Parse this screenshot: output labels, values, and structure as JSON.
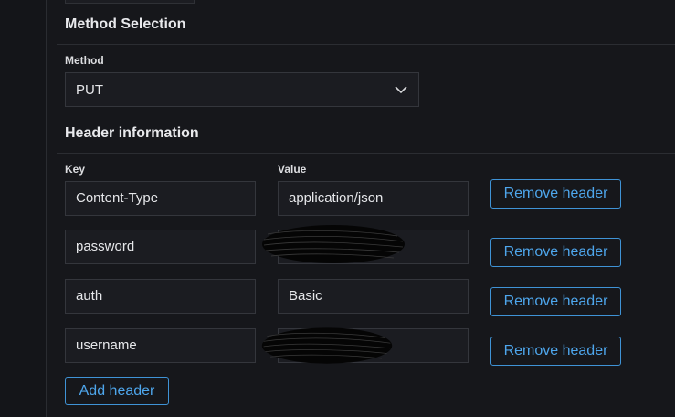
{
  "method_section": {
    "title": "Method Selection",
    "method_label": "Method",
    "method_value": "PUT"
  },
  "header_section": {
    "title": "Header information",
    "key_label": "Key",
    "value_label": "Value",
    "rows": [
      {
        "key": "Content-Type",
        "value": "application/json",
        "redacted": false
      },
      {
        "key": "password",
        "value": "",
        "redacted": true
      },
      {
        "key": "auth",
        "value": "Basic",
        "redacted": false
      },
      {
        "key": "username",
        "value": "",
        "redacted": true
      }
    ],
    "remove_label": "Remove header",
    "add_label": "Add header"
  },
  "colors": {
    "background": "#16171b",
    "input_bg": "#1b1c21",
    "accent": "#4ea6ec"
  }
}
